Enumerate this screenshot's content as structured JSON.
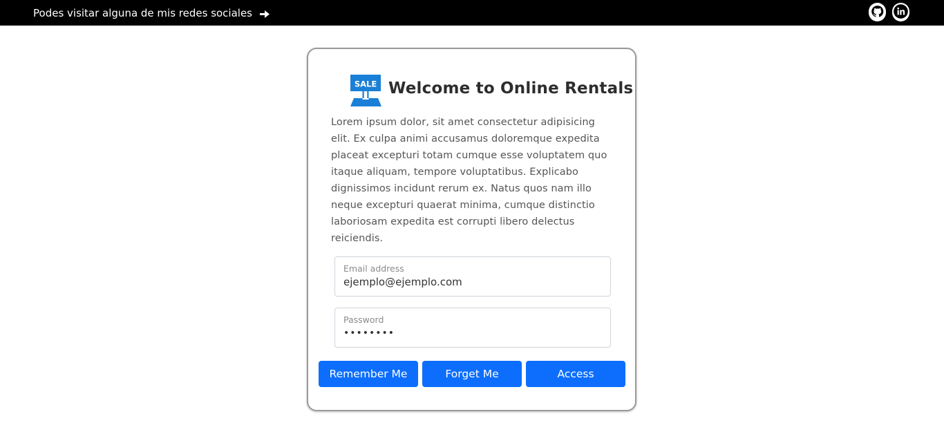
{
  "topbar": {
    "text": "Podes visitar alguna de mis redes sociales",
    "icons": [
      "arrow-right-icon",
      "github-icon",
      "linkedin-icon"
    ]
  },
  "card": {
    "brand_badge": "SALE",
    "title": "Welcome to Online Rentals",
    "description": "Lorem ipsum dolor, sit amet consectetur adipisicing elit. Ex culpa animi accusamus doloremque expedita placeat excepturi totam cumque esse voluptatem quo itaque aliquam, tempore voluptatibus. Explicabo dignissimos incidunt rerum ex. Natus quos nam illo neque excepturi quaerat minima, cumque distinctio laboriosam expedita est corrupti libero delectus reiciendis.",
    "email": {
      "label": "Email address",
      "value": "ejemplo@ejemplo.com"
    },
    "password": {
      "label": "Password",
      "value": "••••••••"
    },
    "buttons": {
      "remember": "Remember Me",
      "forget": "Forget Me",
      "access": "Access"
    }
  },
  "colors": {
    "primary": "#0d6efd",
    "topbar": "#000000",
    "brand_icon": "#1a7fd6"
  }
}
